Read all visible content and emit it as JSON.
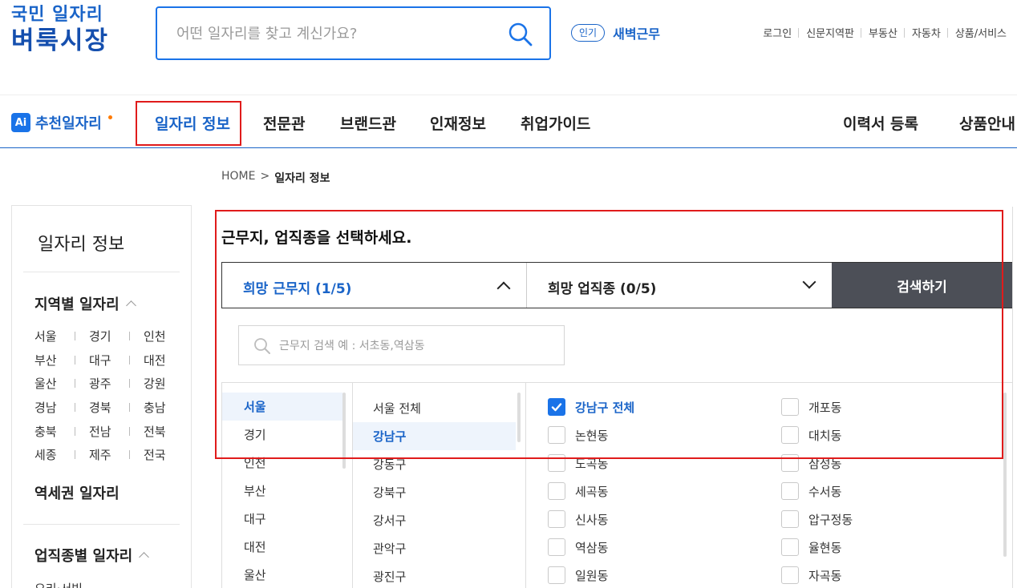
{
  "logo": {
    "line1": "국민 일자리",
    "line2": "벼룩시장"
  },
  "search": {
    "placeholder": "어떤 일자리를 찾고 계신가요?",
    "value": ""
  },
  "popular": {
    "badge": "인기",
    "keyword": "새벽근무"
  },
  "util_links": [
    "로그인",
    "신문지역판",
    "부동산",
    "자동차",
    "상품/서비스"
  ],
  "gnb": {
    "ai_badge": "Ai",
    "ai_label": "추천일자리",
    "items": [
      "일자리 정보",
      "전문관",
      "브랜드관",
      "인재정보",
      "취업가이드"
    ],
    "active_index": 0,
    "right_items": [
      "이력서 등록",
      "상품안내"
    ]
  },
  "breadcrumb": {
    "home": "HOME",
    "sep": ">",
    "current": "일자리 정보"
  },
  "sidebar": {
    "title": "일자리 정보",
    "region_heading": "지역별 일자리",
    "regions": [
      [
        "서울",
        "경기",
        "인천"
      ],
      [
        "부산",
        "대구",
        "대전"
      ],
      [
        "울산",
        "광주",
        "강원"
      ],
      [
        "경남",
        "경북",
        "충남"
      ],
      [
        "충북",
        "전남",
        "전북"
      ],
      [
        "세종",
        "제주",
        "전국"
      ]
    ],
    "station_heading": "역세권 일자리",
    "jobtype_heading": "업직종별 일자리",
    "jobtype_first": "요리·서빙"
  },
  "panel": {
    "title": "근무지, 업직종을 선택하세요.",
    "location_tab": "희망 근무지 (1/5)",
    "jobtype_tab": "희망 업직종 (0/5)",
    "search_button": "검색하기",
    "location_search_placeholder": "근무지 검색 예 : 서초동,역삼동",
    "cities": [
      "서울",
      "경기",
      "인천",
      "부산",
      "대구",
      "대전",
      "울산"
    ],
    "selected_city": "서울",
    "districts": [
      "서울 전체",
      "강남구",
      "강동구",
      "강북구",
      "강서구",
      "관악구",
      "광진구"
    ],
    "selected_district": "강남구",
    "dongs": [
      {
        "label": "강남구 전체",
        "checked": true
      },
      {
        "label": "개포동",
        "checked": false
      },
      {
        "label": "논현동",
        "checked": false
      },
      {
        "label": "대치동",
        "checked": false
      },
      {
        "label": "도곡동",
        "checked": false
      },
      {
        "label": "삼성동",
        "checked": false
      },
      {
        "label": "세곡동",
        "checked": false
      },
      {
        "label": "수서동",
        "checked": false
      },
      {
        "label": "신사동",
        "checked": false
      },
      {
        "label": "압구정동",
        "checked": false
      },
      {
        "label": "역삼동",
        "checked": false
      },
      {
        "label": "율현동",
        "checked": false
      },
      {
        "label": "일원동",
        "checked": false
      },
      {
        "label": "자곡동",
        "checked": false
      }
    ]
  },
  "colors": {
    "brand": "#1a64c8",
    "accent": "#1a73e8",
    "highlight": "#e01b1b",
    "button_dark": "#4c4f57"
  }
}
